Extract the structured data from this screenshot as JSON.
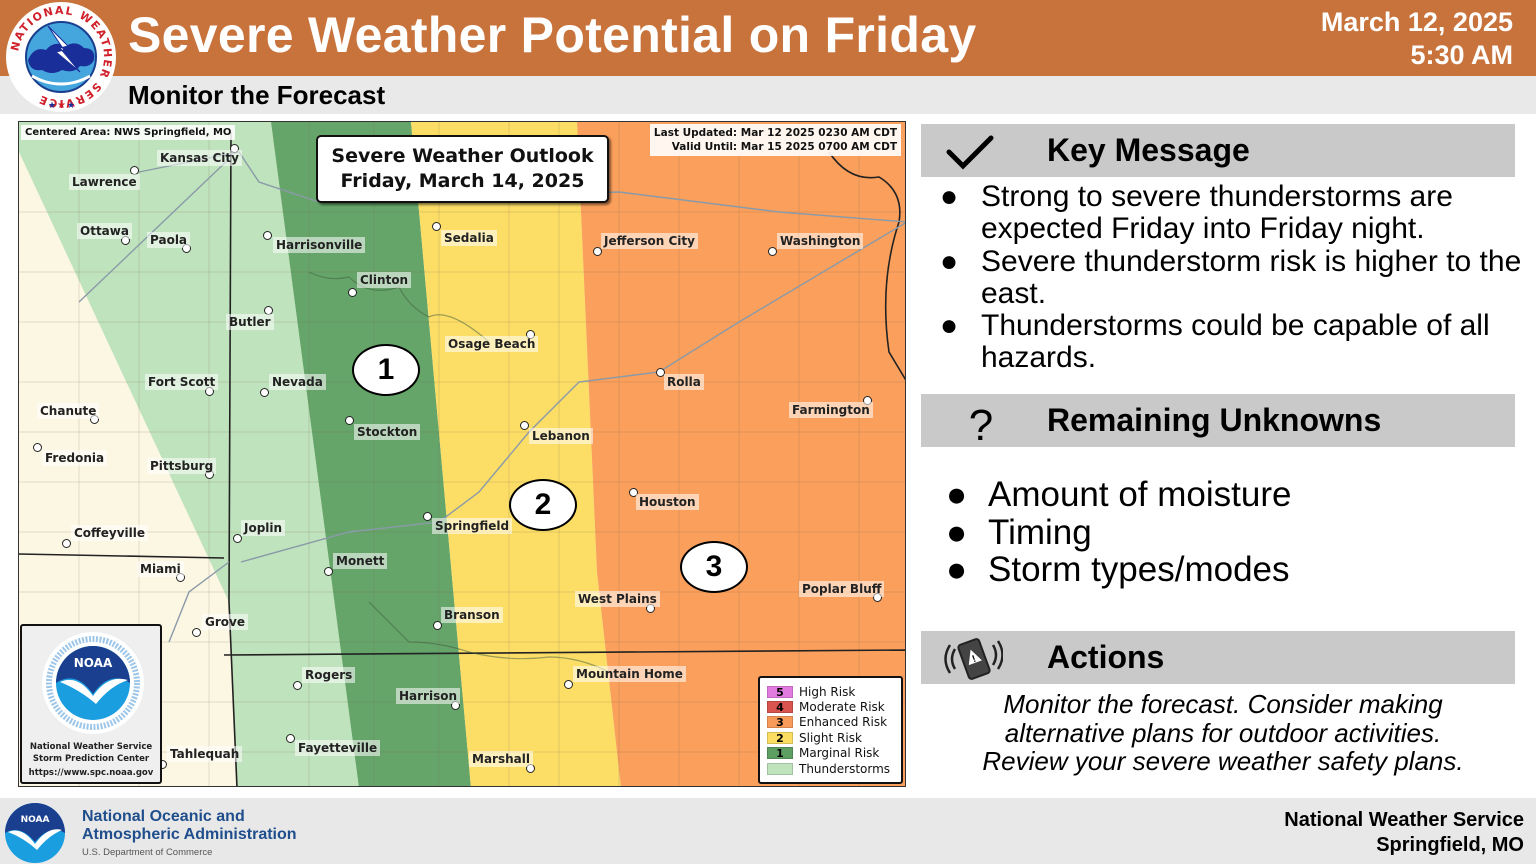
{
  "header": {
    "title": "Severe Weather Potential on Friday",
    "subtitle": "Monitor the Forecast",
    "issue_date": "March 12, 2025",
    "issue_time": "5:30 AM",
    "logo_name": "National Weather Service",
    "logo_ring_text": "NATIONAL WEATHER SERVICE"
  },
  "map": {
    "centered_area": "Centered Area: NWS Springfield, MO",
    "last_updated": "Last Updated: Mar 12 2025 0230 AM CDT",
    "valid_until": "Valid Until: Mar 15 2025 0700 AM CDT",
    "outlook_title": "Severe Weather Outlook",
    "outlook_date": "Friday, March 14, 2025",
    "risk_markers": [
      "1",
      "2",
      "3"
    ],
    "cities": [
      "Kansas City",
      "Lawrence",
      "Ottawa",
      "Paola",
      "Harrisonville",
      "Sedalia",
      "Jefferson City",
      "Washington",
      "Clinton",
      "Butler",
      "Osage Beach",
      "Fort Scott",
      "Nevada",
      "Rolla",
      "Farmington",
      "Chanute",
      "Stockton",
      "Lebanon",
      "Fredonia",
      "Pittsburg",
      "Houston",
      "Coffeyville",
      "Joplin",
      "Springfield",
      "Miami",
      "Monett",
      "Poplar Bluff",
      "West Plains",
      "Grove",
      "Branson",
      "Rogers",
      "Mountain Home",
      "Harrison",
      "Fayetteville",
      "Tahlequah",
      "Marshall"
    ],
    "spc_logo": {
      "badge": "NOAA",
      "ring_text": "NATIONAL OCEANIC AND ATMOSPHERIC ADMINISTRATION · U.S. DEPARTMENT OF COMMERCE",
      "line1": "National Weather Service",
      "line2": "Storm Prediction Center",
      "url": "https://www.spc.noaa.gov"
    },
    "legend": [
      {
        "num": "5",
        "label": "High Risk",
        "color": "#e27be0"
      },
      {
        "num": "4",
        "label": "Moderate Risk",
        "color": "#d9534f"
      },
      {
        "num": "3",
        "label": "Enhanced Risk",
        "color": "#f89b5a"
      },
      {
        "num": "2",
        "label": "Slight Risk",
        "color": "#fbdd62"
      },
      {
        "num": "1",
        "label": "Marginal Risk",
        "color": "#5d9e63"
      },
      {
        "num": "",
        "label": "Thunderstorms",
        "color": "#bfe3bd"
      }
    ],
    "colors": {
      "none": "#fcf7e3",
      "tstm": "#bfe3bd",
      "marginal": "#66a56a",
      "slight": "#fcde67",
      "enhanced": "#fa9f5c"
    }
  },
  "key_message": {
    "title": "Key Message",
    "icon": "checkmark-icon",
    "bullets": [
      "Strong to severe thunderstorms are expected Friday into Friday night.",
      "Severe thunderstorm risk is higher to the east.",
      "Thunderstorms could be capable of all hazards."
    ]
  },
  "unknowns": {
    "title": "Remaining Unknowns",
    "icon": "question-mark-icon",
    "bullets": [
      "Amount of moisture",
      "Timing",
      "Storm types/modes"
    ]
  },
  "actions": {
    "title": "Actions",
    "icon": "phone-alert-icon",
    "text_lines": [
      "Monitor the forecast. Consider making",
      "alternative plans for outdoor activities.",
      "Review your severe weather safety plans."
    ]
  },
  "footer": {
    "org_line1": "National Oceanic and",
    "org_line2": "Atmospheric Administration",
    "dept": "U.S. Department of Commerce",
    "office_line1": "National Weather Service",
    "office_line2": "Springfield, MO",
    "logo_badge": "NOAA"
  },
  "bullet_glyph": "●",
  "theme": {
    "header_color": "#c8733b",
    "section_header_color": "#c9c9c9",
    "noaa_blue": "#1f4e8c"
  }
}
